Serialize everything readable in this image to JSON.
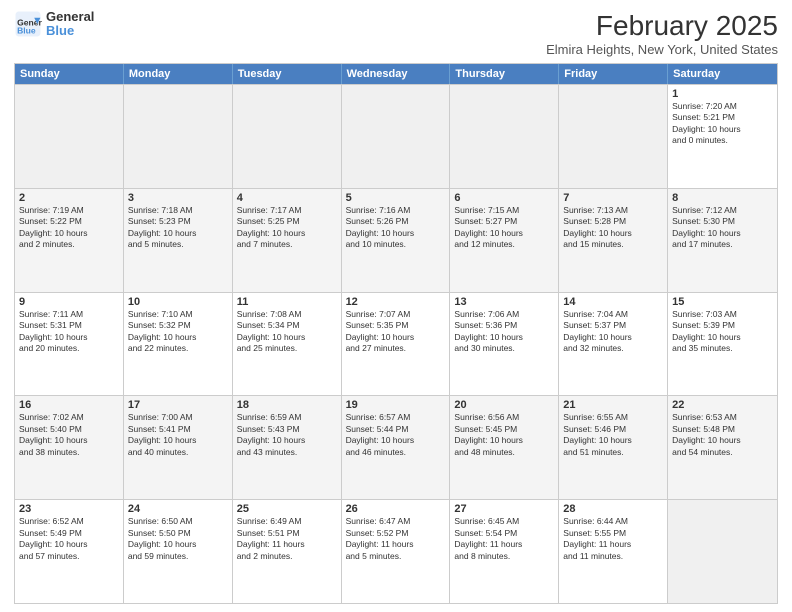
{
  "header": {
    "logo_line1": "General",
    "logo_line2": "Blue",
    "month": "February 2025",
    "location": "Elmira Heights, New York, United States"
  },
  "days": [
    "Sunday",
    "Monday",
    "Tuesday",
    "Wednesday",
    "Thursday",
    "Friday",
    "Saturday"
  ],
  "weeks": [
    [
      {
        "num": "",
        "info": ""
      },
      {
        "num": "",
        "info": ""
      },
      {
        "num": "",
        "info": ""
      },
      {
        "num": "",
        "info": ""
      },
      {
        "num": "",
        "info": ""
      },
      {
        "num": "",
        "info": ""
      },
      {
        "num": "1",
        "info": "Sunrise: 7:20 AM\nSunset: 5:21 PM\nDaylight: 10 hours\nand 0 minutes."
      }
    ],
    [
      {
        "num": "2",
        "info": "Sunrise: 7:19 AM\nSunset: 5:22 PM\nDaylight: 10 hours\nand 2 minutes."
      },
      {
        "num": "3",
        "info": "Sunrise: 7:18 AM\nSunset: 5:23 PM\nDaylight: 10 hours\nand 5 minutes."
      },
      {
        "num": "4",
        "info": "Sunrise: 7:17 AM\nSunset: 5:25 PM\nDaylight: 10 hours\nand 7 minutes."
      },
      {
        "num": "5",
        "info": "Sunrise: 7:16 AM\nSunset: 5:26 PM\nDaylight: 10 hours\nand 10 minutes."
      },
      {
        "num": "6",
        "info": "Sunrise: 7:15 AM\nSunset: 5:27 PM\nDaylight: 10 hours\nand 12 minutes."
      },
      {
        "num": "7",
        "info": "Sunrise: 7:13 AM\nSunset: 5:28 PM\nDaylight: 10 hours\nand 15 minutes."
      },
      {
        "num": "8",
        "info": "Sunrise: 7:12 AM\nSunset: 5:30 PM\nDaylight: 10 hours\nand 17 minutes."
      }
    ],
    [
      {
        "num": "9",
        "info": "Sunrise: 7:11 AM\nSunset: 5:31 PM\nDaylight: 10 hours\nand 20 minutes."
      },
      {
        "num": "10",
        "info": "Sunrise: 7:10 AM\nSunset: 5:32 PM\nDaylight: 10 hours\nand 22 minutes."
      },
      {
        "num": "11",
        "info": "Sunrise: 7:08 AM\nSunset: 5:34 PM\nDaylight: 10 hours\nand 25 minutes."
      },
      {
        "num": "12",
        "info": "Sunrise: 7:07 AM\nSunset: 5:35 PM\nDaylight: 10 hours\nand 27 minutes."
      },
      {
        "num": "13",
        "info": "Sunrise: 7:06 AM\nSunset: 5:36 PM\nDaylight: 10 hours\nand 30 minutes."
      },
      {
        "num": "14",
        "info": "Sunrise: 7:04 AM\nSunset: 5:37 PM\nDaylight: 10 hours\nand 32 minutes."
      },
      {
        "num": "15",
        "info": "Sunrise: 7:03 AM\nSunset: 5:39 PM\nDaylight: 10 hours\nand 35 minutes."
      }
    ],
    [
      {
        "num": "16",
        "info": "Sunrise: 7:02 AM\nSunset: 5:40 PM\nDaylight: 10 hours\nand 38 minutes."
      },
      {
        "num": "17",
        "info": "Sunrise: 7:00 AM\nSunset: 5:41 PM\nDaylight: 10 hours\nand 40 minutes."
      },
      {
        "num": "18",
        "info": "Sunrise: 6:59 AM\nSunset: 5:43 PM\nDaylight: 10 hours\nand 43 minutes."
      },
      {
        "num": "19",
        "info": "Sunrise: 6:57 AM\nSunset: 5:44 PM\nDaylight: 10 hours\nand 46 minutes."
      },
      {
        "num": "20",
        "info": "Sunrise: 6:56 AM\nSunset: 5:45 PM\nDaylight: 10 hours\nand 48 minutes."
      },
      {
        "num": "21",
        "info": "Sunrise: 6:55 AM\nSunset: 5:46 PM\nDaylight: 10 hours\nand 51 minutes."
      },
      {
        "num": "22",
        "info": "Sunrise: 6:53 AM\nSunset: 5:48 PM\nDaylight: 10 hours\nand 54 minutes."
      }
    ],
    [
      {
        "num": "23",
        "info": "Sunrise: 6:52 AM\nSunset: 5:49 PM\nDaylight: 10 hours\nand 57 minutes."
      },
      {
        "num": "24",
        "info": "Sunrise: 6:50 AM\nSunset: 5:50 PM\nDaylight: 10 hours\nand 59 minutes."
      },
      {
        "num": "25",
        "info": "Sunrise: 6:49 AM\nSunset: 5:51 PM\nDaylight: 11 hours\nand 2 minutes."
      },
      {
        "num": "26",
        "info": "Sunrise: 6:47 AM\nSunset: 5:52 PM\nDaylight: 11 hours\nand 5 minutes."
      },
      {
        "num": "27",
        "info": "Sunrise: 6:45 AM\nSunset: 5:54 PM\nDaylight: 11 hours\nand 8 minutes."
      },
      {
        "num": "28",
        "info": "Sunrise: 6:44 AM\nSunset: 5:55 PM\nDaylight: 11 hours\nand 11 minutes."
      },
      {
        "num": "",
        "info": ""
      }
    ]
  ]
}
